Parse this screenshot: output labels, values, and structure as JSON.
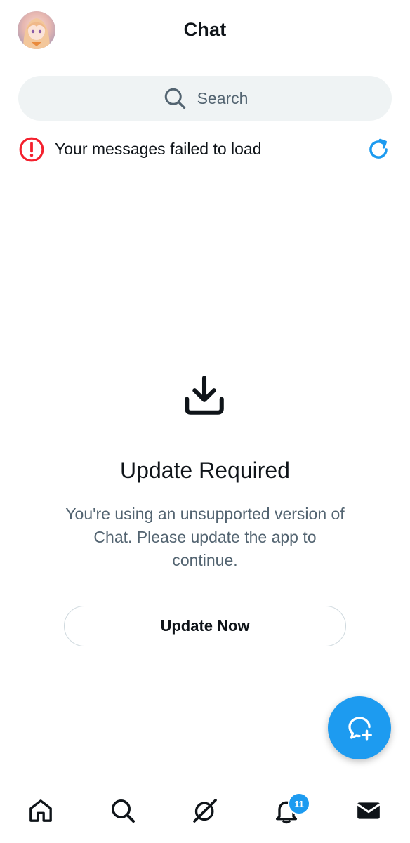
{
  "header": {
    "title": "Chat"
  },
  "search": {
    "placeholder": "Search"
  },
  "error": {
    "message": "Your messages failed to load"
  },
  "update": {
    "title": "Update Required",
    "body": "You're using an unsupported version of Chat. Please update the app to continue.",
    "button_label": "Update Now"
  },
  "nav": {
    "items": [
      "home-icon",
      "search-icon",
      "grok-icon",
      "notifications-icon",
      "messages-icon"
    ],
    "notifications_badge": "11"
  },
  "colors": {
    "accent": "#1d9bf0",
    "error": "#f4212e",
    "text": "#0f1419",
    "secondary": "#536471"
  }
}
